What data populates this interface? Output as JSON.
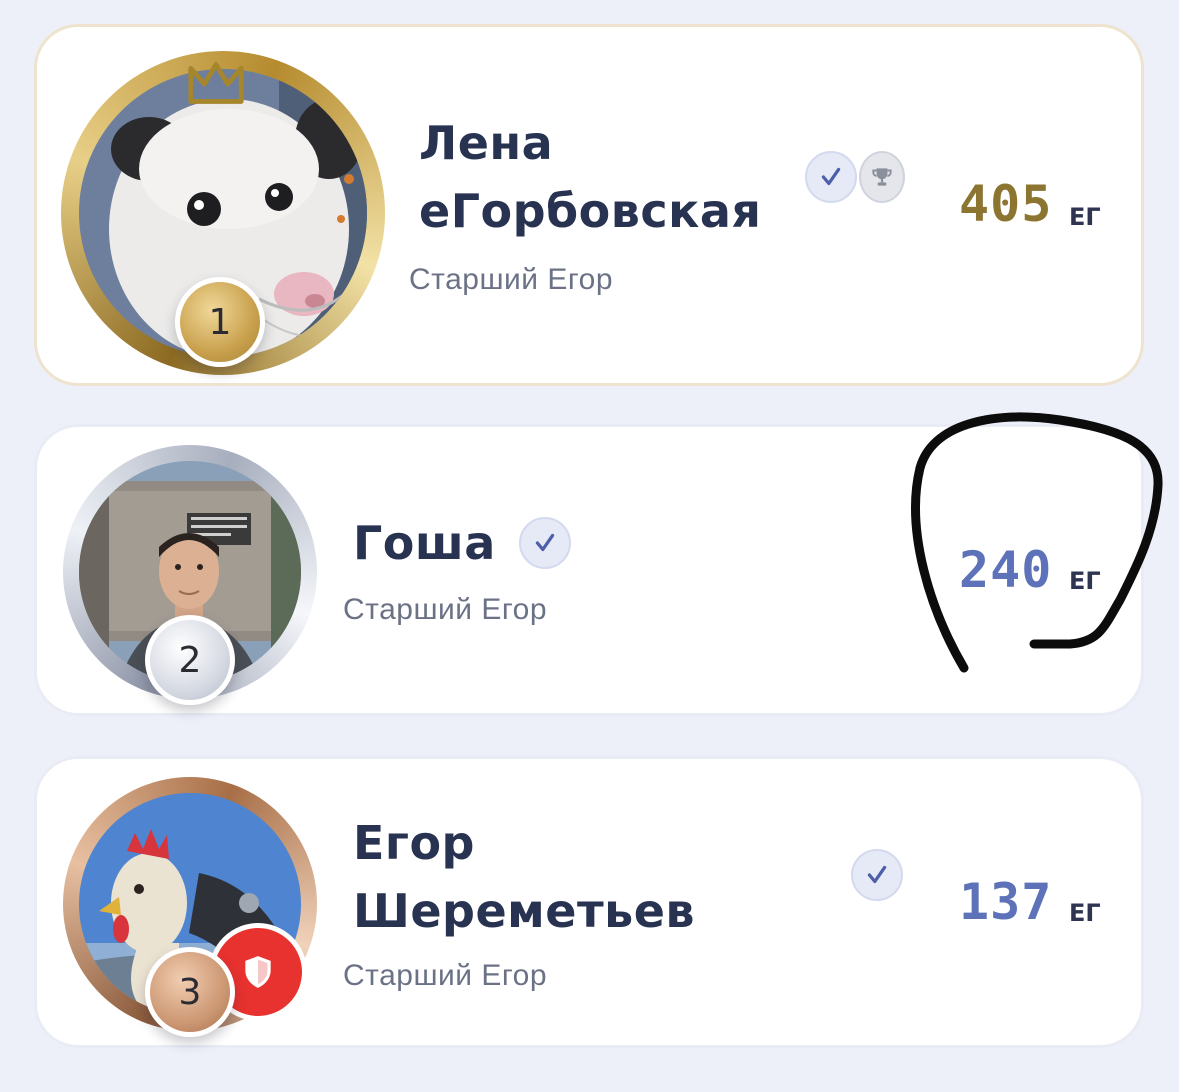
{
  "leaderboard": [
    {
      "place": "1",
      "name_line1": "Лена",
      "name_line2": "еГорбовская",
      "role": "Старший Егор",
      "score": "405",
      "unit": "ЕГ",
      "verified": true,
      "trophy": true,
      "ring": "gold",
      "score_color": "#8c7431"
    },
    {
      "place": "2",
      "name_line1": "Гоша",
      "role": "Старший Егор",
      "score": "240",
      "unit": "ЕГ",
      "verified": true,
      "ring": "silver",
      "score_color": "#5d72b8"
    },
    {
      "place": "3",
      "name_line1": "Егор",
      "name_line2": "Шереметьев",
      "role": "Старший Егор",
      "score": "137",
      "unit": "ЕГ",
      "verified": true,
      "moderator_shield": true,
      "ring": "bronze",
      "score_color": "#5d72b8"
    }
  ],
  "icons": {
    "crown": "crown-icon",
    "verified": "checkmark-icon",
    "trophy": "trophy-icon",
    "shield": "shield-icon"
  },
  "colors": {
    "background": "#edf0f8",
    "card": "#ffffff",
    "name": "#283251",
    "gold": "#c9a14e",
    "accent_blue": "#5d72b8",
    "shield_red": "#e8322f"
  }
}
